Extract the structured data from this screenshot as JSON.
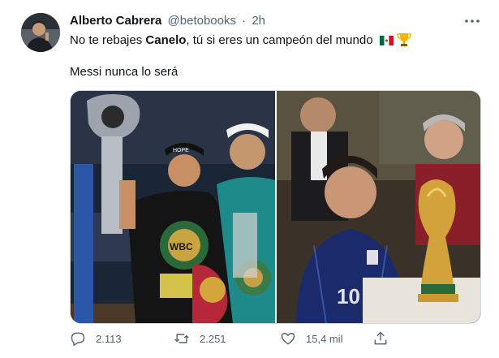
{
  "tweet": {
    "author_name": "Alberto Cabrera",
    "handle": "@betobooks",
    "separator": "·",
    "time": "2h",
    "text_part1": "No te rebajes ",
    "text_bold": "Canelo",
    "text_part2": ", tú si eres un campeón del mundo",
    "text_line2": "Messi nunca lo será"
  },
  "actions": {
    "reply_count": "2.113",
    "retweet_count": "2.251",
    "like_count": "15,4 mil"
  },
  "photo_text": {
    "belt_letters": "WBC",
    "jersey_number": "10"
  },
  "colors": {
    "text_primary": "#0f1419",
    "text_secondary": "#536471",
    "border": "#cfd9de",
    "background": "#ffffff"
  }
}
